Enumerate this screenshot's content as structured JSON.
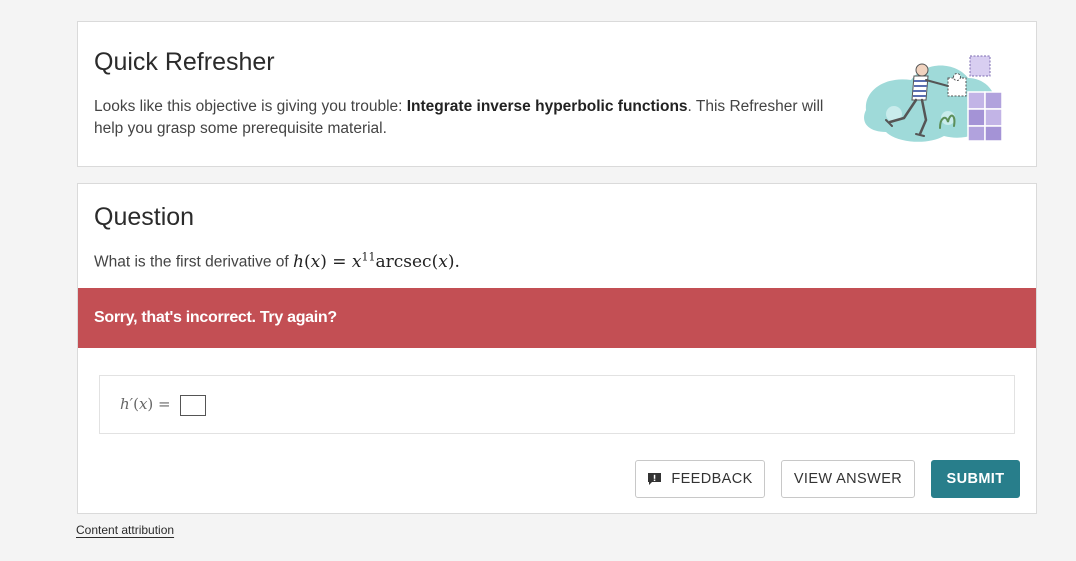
{
  "refresher": {
    "title": "Quick Refresher",
    "text_before": "Looks like this objective is giving you trouble: ",
    "objective": "Integrate inverse hyperbolic functions",
    "text_after": ". This Refresher will help you grasp some prerequisite material."
  },
  "question": {
    "title": "Question",
    "prompt": "What is the first derivative of ",
    "fn_name": "h",
    "var": "x",
    "equals": "=",
    "exponent": "11",
    "func": "arcsec",
    "end": "."
  },
  "feedback_banner": {
    "message": "Sorry, that's incorrect. Try again?",
    "color": "#c34f54"
  },
  "answer": {
    "label_fn": "h′",
    "label_var": "x",
    "equals": "=",
    "value": ""
  },
  "buttons": {
    "feedback": "FEEDBACK",
    "feedback_icon": "feedback-icon",
    "view_answer": "VIEW ANSWER",
    "submit": "SUBMIT",
    "submit_color": "#287e8b"
  },
  "footer": {
    "attribution": "Content attribution"
  }
}
